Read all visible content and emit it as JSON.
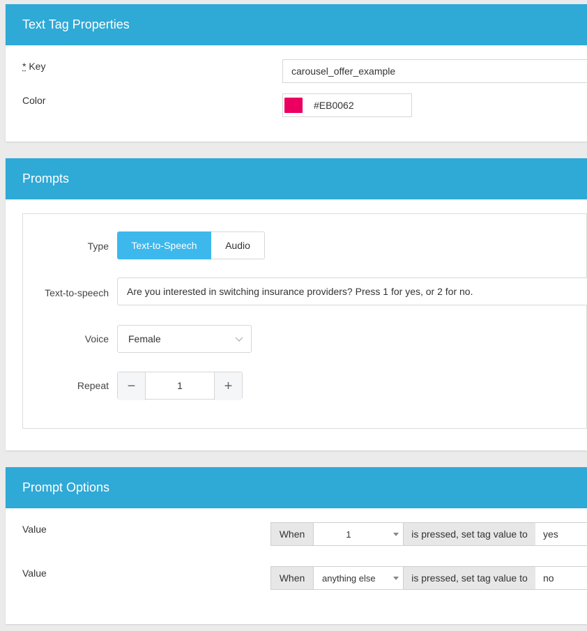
{
  "text_tag_properties": {
    "title": "Text Tag Properties",
    "key_label_required": "*",
    "key_label": "Key",
    "key_value": "carousel_offer_example",
    "color_label": "Color",
    "color_value": "#EB0062",
    "swatch_color": "#EB0062"
  },
  "prompts": {
    "title": "Prompts",
    "type_label": "Type",
    "type_options": [
      "Text-to-Speech",
      "Audio"
    ],
    "type_selected": "Text-to-Speech",
    "tts_label": "Text-to-speech",
    "tts_value": "Are you interested in switching insurance providers? Press 1 for yes, or 2 for no.",
    "voice_label": "Voice",
    "voice_value": "Female",
    "repeat_label": "Repeat",
    "repeat_value": "1",
    "minus_symbol": "−",
    "plus_symbol": "+"
  },
  "prompt_options": {
    "title": "Prompt Options",
    "rows": [
      {
        "label": "Value",
        "when": "When",
        "key": "1",
        "pressed_text": "is pressed, set tag value to",
        "tag_value": "yes"
      },
      {
        "label": "Value",
        "when": "When",
        "key": "anything else",
        "pressed_text": "is pressed, set tag value to",
        "tag_value": "no"
      }
    ]
  },
  "colors": {
    "header": "#2FA9D6",
    "accent": "#3DB8EC"
  }
}
